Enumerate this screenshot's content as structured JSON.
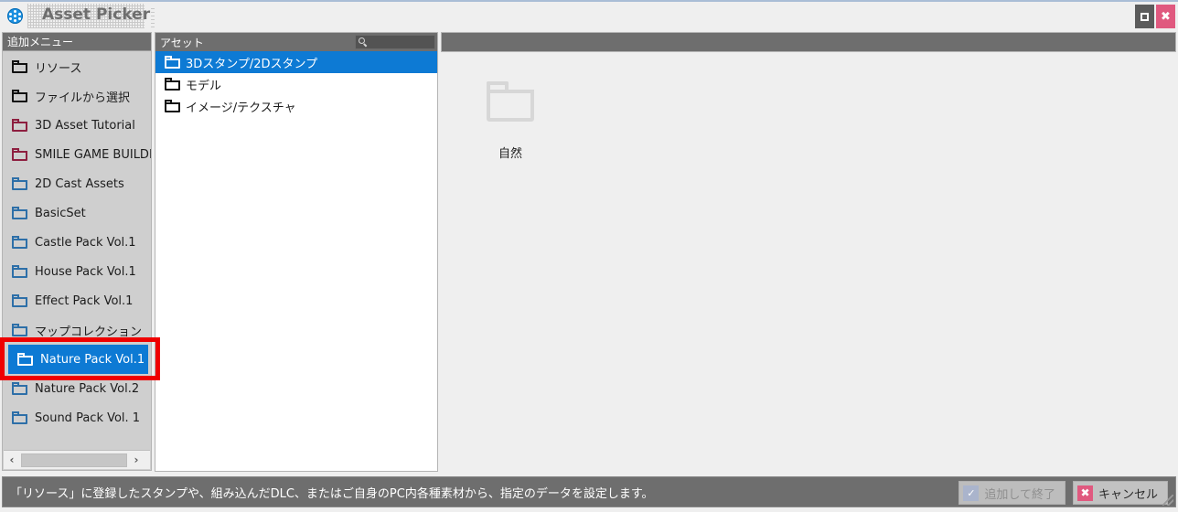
{
  "window": {
    "title": "Asset Picker",
    "app_icon": "app-circle-icon",
    "maximize_label": "□",
    "close_label": "✖"
  },
  "left_panel": {
    "header": "追加メニュー",
    "items": [
      {
        "label": "リソース",
        "color": "fc-black",
        "selected": false
      },
      {
        "label": "ファイルから選択",
        "color": "fc-black",
        "selected": false
      },
      {
        "label": "3D Asset Tutorial",
        "color": "fc-maroon",
        "selected": false
      },
      {
        "label": "SMILE GAME BUILDER",
        "color": "fc-maroon",
        "selected": false
      },
      {
        "label": "2D Cast Assets",
        "color": "fc-blue",
        "selected": false
      },
      {
        "label": "BasicSet",
        "color": "fc-blue",
        "selected": false
      },
      {
        "label": "Castle Pack Vol.1",
        "color": "fc-blue",
        "selected": false
      },
      {
        "label": "House Pack Vol.1",
        "color": "fc-blue",
        "selected": false
      },
      {
        "label": "Effect Pack Vol.1",
        "color": "fc-blue",
        "selected": false
      },
      {
        "label": "マップコレクション",
        "color": "fc-blue",
        "selected": false
      },
      {
        "label": "Nature Pack Vol.1",
        "color": "fc-white",
        "selected": true
      },
      {
        "label": "Nature Pack Vol.2",
        "color": "fc-blue",
        "selected": false
      },
      {
        "label": "Sound Pack Vol. 1",
        "color": "fc-blue",
        "selected": false
      }
    ],
    "scroll_left_label": "‹",
    "scroll_right_label": "›"
  },
  "asset_panel": {
    "header": "アセット",
    "search_placeholder": "",
    "search_value": "",
    "items": [
      {
        "label": "3Dスタンプ/2Dスタンプ",
        "selected": true
      },
      {
        "label": "モデル",
        "selected": false
      },
      {
        "label": "イメージ/テクスチャ",
        "selected": false
      }
    ]
  },
  "main_panel": {
    "thumbnails": [
      {
        "label": "自然"
      }
    ]
  },
  "statusbar": {
    "text": "「リソース」に登録したスタンプや、組み込んだDLC、またはご自身のPC内各種素材から、指定のデータを設定します。",
    "confirm_button": "追加して終了",
    "confirm_icon": "✓",
    "cancel_button": "キャンセル",
    "cancel_icon": "✖"
  },
  "colors": {
    "selection_blue": "#0d7ad4",
    "header_gray": "#6e6e6e",
    "accent_pink": "#e0597f",
    "annotation_red": "#ef0000"
  }
}
